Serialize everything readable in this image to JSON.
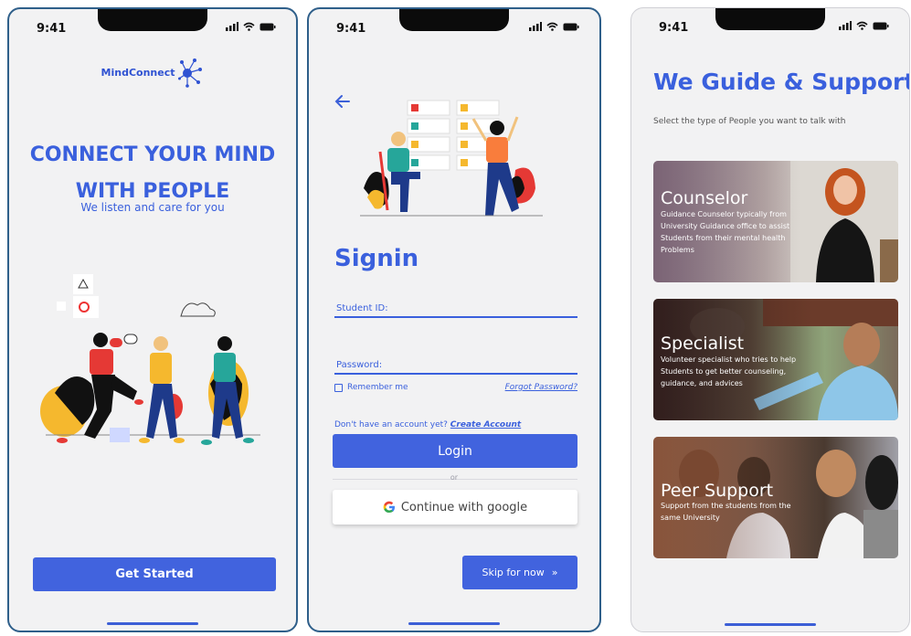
{
  "status": {
    "time": "9:41"
  },
  "screen1": {
    "brand": "MindConnect",
    "title_line1": "CONNECT YOUR MIND",
    "title_line2": "WITH PEOPLE",
    "subtitle": "We listen and care for you",
    "cta": "Get Started"
  },
  "screen2": {
    "title": "Signin",
    "student_id_label": "Student ID:",
    "password_label": "Password:",
    "remember_label": "Remember me",
    "forgot_label": "Forgot Password?",
    "no_account": "Don't have an account yet?",
    "create_account": "Create Account",
    "login": "Login",
    "or": "or",
    "google": "Continue with google",
    "skip": "Skip for now",
    "skip_icon": "»"
  },
  "screen3": {
    "title": "We Guide & Support!",
    "subtitle": "Select the type of People you want to talk with",
    "cards": [
      {
        "title": "Counselor",
        "desc": "Guidance Counselor typically from University Guidance office to assist Students from their mental health Problems"
      },
      {
        "title": "Specialist",
        "desc": "Volunteer specialist who tries to help Students to get better counseling, guidance, and advices"
      },
      {
        "title": "Peer Support",
        "desc": "Support from the students from the same University"
      }
    ]
  },
  "colors": {
    "accent": "#4163de",
    "bg": "#f2f2f3"
  }
}
